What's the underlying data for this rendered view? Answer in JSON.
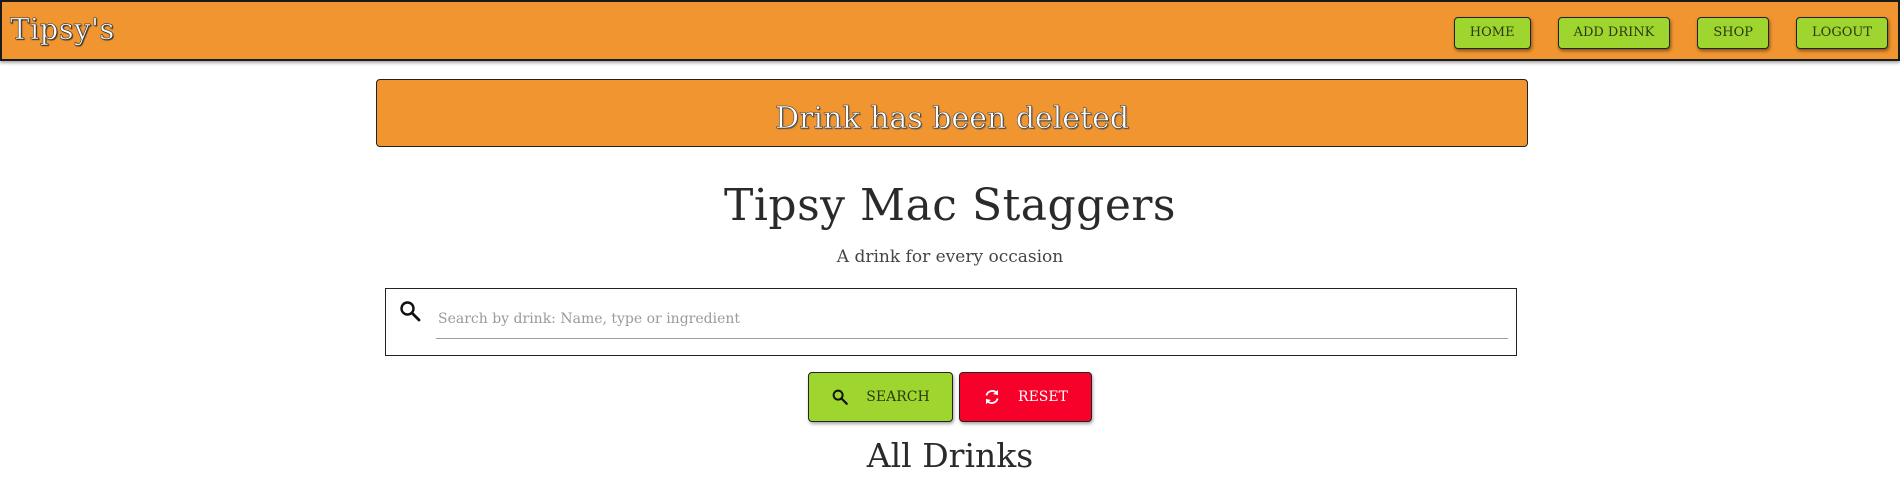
{
  "navbar": {
    "brand": "Tipsy's",
    "links": [
      {
        "label": "HOME"
      },
      {
        "label": "ADD DRINK"
      },
      {
        "label": "SHOP"
      },
      {
        "label": "LOGOUT"
      }
    ]
  },
  "flash": {
    "message": "Drink has been deleted"
  },
  "hero": {
    "title": "Tipsy Mac Staggers",
    "subtitle": "A drink for every occasion"
  },
  "search": {
    "placeholder": "Search by drink: Name, type or ingredient",
    "value": "",
    "search_label": "SEARCH",
    "reset_label": "RESET"
  },
  "section": {
    "title": "All Drinks"
  },
  "colors": {
    "navbar_bg": "#f0952f",
    "nav_button_bg": "#9fd52f",
    "reset_button_bg": "#f7002a",
    "flash_bg": "#f0952f"
  },
  "icons": {
    "search": "search-icon",
    "reset": "refresh-icon"
  }
}
